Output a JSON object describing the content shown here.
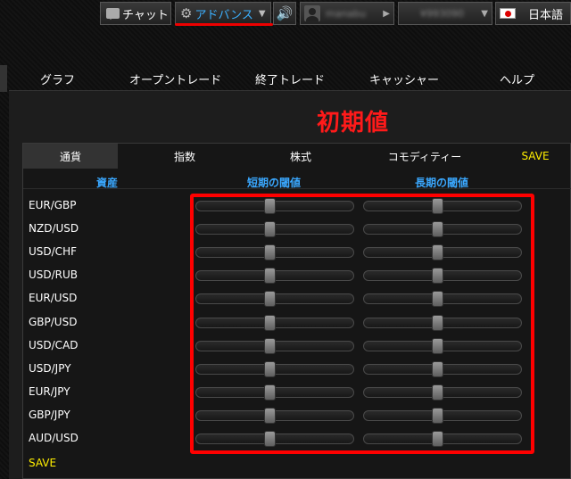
{
  "topbar": {
    "chat_label": "チャット",
    "advanced_label": "アドバンス",
    "username": "manabu",
    "balance": "¥993090",
    "language": "日本語"
  },
  "nav": {
    "items": [
      "グラフ",
      "オープントレード",
      "終了トレード",
      "キャッシャー",
      "ヘルプ"
    ]
  },
  "heading": "初期値",
  "tabs": {
    "items": [
      "通貨",
      "指数",
      "株式",
      "コモディティー",
      "SAVE"
    ],
    "active_index": 0
  },
  "columns": {
    "asset": "資産",
    "short_threshold": "短期の閾値",
    "long_threshold": "長期の閾値"
  },
  "rows": [
    {
      "pair": "EUR/GBP",
      "short": 0.46,
      "long": 0.46
    },
    {
      "pair": "NZD/USD",
      "short": 0.46,
      "long": 0.46
    },
    {
      "pair": "USD/CHF",
      "short": 0.46,
      "long": 0.46
    },
    {
      "pair": "USD/RUB",
      "short": 0.46,
      "long": 0.46
    },
    {
      "pair": "EUR/USD",
      "short": 0.46,
      "long": 0.46
    },
    {
      "pair": "GBP/USD",
      "short": 0.46,
      "long": 0.46
    },
    {
      "pair": "USD/CAD",
      "short": 0.46,
      "long": 0.46
    },
    {
      "pair": "USD/JPY",
      "short": 0.46,
      "long": 0.46
    },
    {
      "pair": "EUR/JPY",
      "short": 0.46,
      "long": 0.46
    },
    {
      "pair": "GBP/JPY",
      "short": 0.46,
      "long": 0.46
    },
    {
      "pair": "AUD/USD",
      "short": 0.46,
      "long": 0.46
    }
  ],
  "save_label": "SAVE",
  "colors": {
    "accent_blue": "#3aa8ff",
    "save_yellow": "#ffee00",
    "annotation_red": "#ff0000"
  },
  "icons": {
    "chat": "chat-bubble-icon",
    "advanced": "gear-icon",
    "sound": "speaker-icon",
    "user": "user-avatar-icon",
    "language": "japan-flag-icon"
  }
}
